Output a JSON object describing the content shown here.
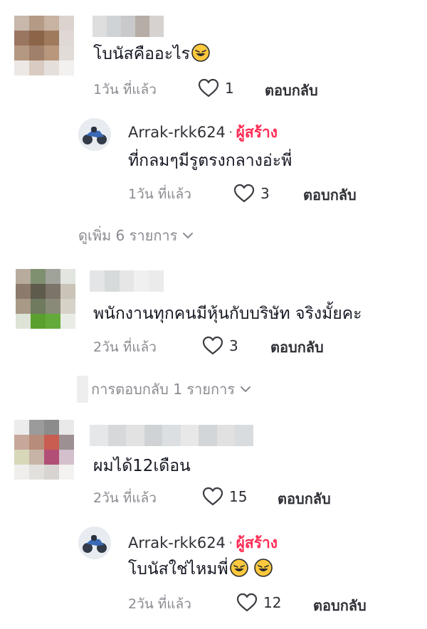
{
  "comments": [
    {
      "text": "โบนัสคืออะไร",
      "emoji": "rolling-on-floor-laughing",
      "time": "1วัน ที่แล้ว",
      "likes": "1",
      "reply_label": "ตอบกลับ",
      "avatar_colors": [
        "#c8b8ac",
        "#b59a85",
        "#c8b2a1",
        "#dcd3ce",
        "#9a7560",
        "#8c6549",
        "#a07a5d",
        "#dfd8d5",
        "#b59882",
        "#a1806b",
        "#b9977d",
        "#e2dcd9",
        "#ece8e6",
        "#d9cbc1",
        "#e5dfdb",
        "#f3f1f0"
      ],
      "name_colors": [
        "#dedede",
        "#cfd3d6",
        "#c9c9cb",
        "#b6ada6",
        "#d5d2cf"
      ]
    },
    {
      "text": "พนักงานทุกคนมีหุ้นกับบริษัท จริงมั้ยคะ",
      "time": "2วัน ที่แล้ว",
      "likes": "3",
      "reply_label": "ตอบกลับ",
      "avatar_colors": [
        "#b7ab9d",
        "#7f9070",
        "#a0a39a",
        "#e2e5e0",
        "#8c7a6c",
        "#5e5a4c",
        "#7c7468",
        "#c9c3b8",
        "#a89a86",
        "#6f7a5e",
        "#8a8a78",
        "#d6d2c8",
        "#dde3d6",
        "#5aa02e",
        "#64aa3a",
        "#e8ece4"
      ],
      "name_colors": [
        "#e3e5e6",
        "#d7dadb",
        "#e6e6e6",
        "#f0f0f0",
        "#ebebeb"
      ]
    },
    {
      "text": "ผมได้12เดือน",
      "time": "2วัน ที่แล้ว",
      "likes": "15",
      "reply_label": "ตอบกลับ",
      "avatar_colors": [
        "#ececec",
        "#9b9b9b",
        "#8c8c8c",
        "#e9e9e9",
        "#c7a79a",
        "#b88c7a",
        "#c95d52",
        "#9d9092",
        "#d7d8b8",
        "#c8b4a6",
        "#b24f77",
        "#d4c0cc",
        "#f0eeec",
        "#e2e0dd",
        "#d8d4d2",
        "#f4f2f1"
      ],
      "name_colors": [
        "#e5e7e8",
        "#d6d8da",
        "#e2e2e2",
        "#cfd3d5",
        "#dcdfe1",
        "#e8e8e8",
        "#d3d6d8",
        "#e1e1e1",
        "#d9dcde"
      ]
    }
  ],
  "replies": [
    {
      "author": "Arrak-rkk624",
      "separator": "·",
      "creator_label": "ผู้สร้าง",
      "text": "ที่กลมๆมีรูตรงกลางอ่ะพี่",
      "time": "1วัน ที่แล้ว",
      "likes": "3",
      "reply_label": "ตอบกลับ"
    },
    {
      "author": "Arrak-rkk624",
      "separator": "·",
      "creator_label": "ผู้สร้าง",
      "text": "โบนัสใช่ไหมพี่",
      "emoji": "rolling-on-floor-laughing",
      "time": "2วัน ที่แล้ว",
      "likes": "12",
      "reply_label": "ตอบกลับ"
    }
  ],
  "view_more_1": "ดูเพิ่ม 6 รายการ",
  "view_replies_2": "การตอบกลับ 1 รายการ"
}
